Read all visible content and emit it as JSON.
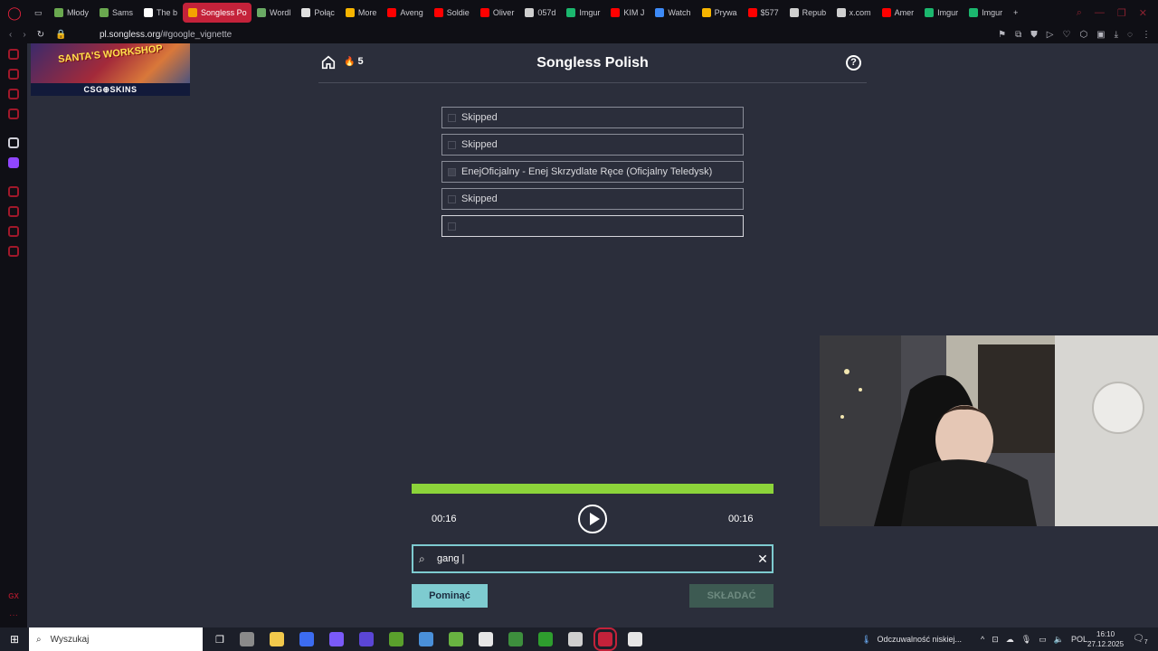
{
  "browser": {
    "tabs": [
      {
        "label": "Młody",
        "color": "#6aa84f"
      },
      {
        "label": "Sams",
        "color": "#6aa84f"
      },
      {
        "label": "The b",
        "color": "#ffffff"
      },
      {
        "label": "Songless Po",
        "color": "#f4a300",
        "active": true
      },
      {
        "label": "Wordl",
        "color": "#6aaa64"
      },
      {
        "label": "Połąc",
        "color": "#e0e0e0"
      },
      {
        "label": "More",
        "color": "#f7b500"
      },
      {
        "label": "Aveng",
        "color": "#ff0000"
      },
      {
        "label": "Soldie",
        "color": "#ff0000"
      },
      {
        "label": "Oliver",
        "color": "#ff0000"
      },
      {
        "label": "057d",
        "color": "#cfcfcf"
      },
      {
        "label": "Imgur",
        "color": "#1bb76e"
      },
      {
        "label": "KIM J",
        "color": "#ff0000"
      },
      {
        "label": "Watch",
        "color": "#3d8af7"
      },
      {
        "label": "Prywa",
        "color": "#f7b500"
      },
      {
        "label": "$577",
        "color": "#ff0000"
      },
      {
        "label": "Repub",
        "color": "#cfcfcf"
      },
      {
        "label": "x.com",
        "color": "#cfcfcf"
      },
      {
        "label": "Amer",
        "color": "#ff0000"
      },
      {
        "label": "Imgur",
        "color": "#1bb76e"
      },
      {
        "label": "Imgur",
        "color": "#1bb76e"
      }
    ],
    "url_host": "pl.songless.org",
    "url_path": "/#google_vignette"
  },
  "ad": {
    "title": "SANTA'S WORKSHOP",
    "brand": "CSG⊕SKINS"
  },
  "game": {
    "title": "Songless Polish",
    "streak": "5",
    "streak_icon": "🔥",
    "guesses": [
      {
        "text": "Skipped",
        "state": "skipped"
      },
      {
        "text": "Skipped",
        "state": "skipped"
      },
      {
        "text": "EnejOficjalny - Enej Skrzydlate Ręce (Oficjalny Teledysk)",
        "state": "wrong"
      },
      {
        "text": "Skipped",
        "state": "skipped"
      },
      {
        "text": "",
        "state": "empty"
      }
    ],
    "progress_percent": 100,
    "progress_color": "#8cd43a",
    "time_elapsed": "00:16",
    "time_total": "00:16",
    "search_value": "gang |",
    "skip_label": "Pominąć",
    "submit_label": "SKŁADAĆ"
  },
  "taskbar": {
    "search_placeholder": "Wyszukaj",
    "weather_text": "Odczuwalność niskiej...",
    "language": "POL",
    "time": "16:10",
    "date": "27.12.2025",
    "notifications": "7",
    "apps": [
      "#8a8a8a",
      "#f2c94c",
      "#3c6cf0",
      "#7a5af8",
      "#5b46d6",
      "#5aa02c",
      "#4a90d9",
      "#68b341",
      "#e6e6e6",
      "#3d8f3d",
      "#2e9e2e",
      "#cfcfcf",
      "#c4223a",
      "#e6e6e6"
    ]
  }
}
